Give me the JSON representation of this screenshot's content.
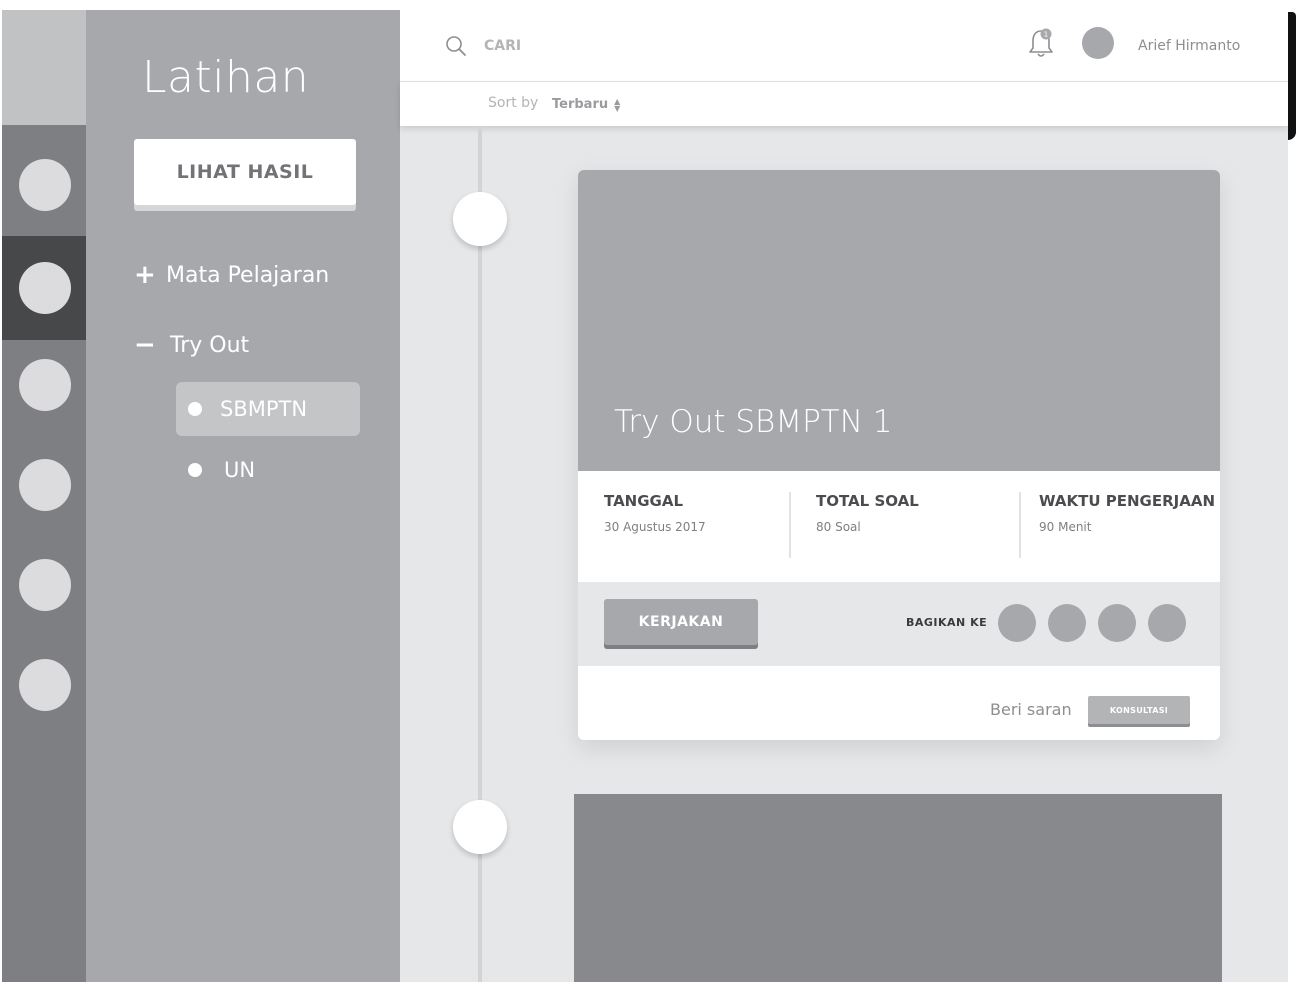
{
  "sidebar": {
    "title": "Latihan",
    "primary_button": "LIHAT HASIL",
    "menu": [
      {
        "sign": "+",
        "label": "Mata Pelajaran"
      },
      {
        "sign": "−",
        "label": "Try Out"
      }
    ],
    "submenu": [
      {
        "label": "SBMPTN",
        "active": true
      },
      {
        "label": "UN",
        "active": false
      }
    ]
  },
  "topbar": {
    "search_label": "CARI",
    "notification_count": "1",
    "user_name": "Arief Hirmanto"
  },
  "sortbar": {
    "label": "Sort by",
    "value": "Terbaru"
  },
  "card": {
    "title": "Try Out SBMPTN 1",
    "stats": [
      {
        "label": "TANGGAL",
        "value": "30 Agustus 2017"
      },
      {
        "label": "TOTAL SOAL",
        "value": "80 Soal"
      },
      {
        "label": "WAKTU PENGERJAAN",
        "value": "90 Menit"
      }
    ],
    "action_button": "KERJAKAN",
    "share_label": "BAGIKAN KE",
    "suggest_label": "Beri saran",
    "consult_button": "KONSULTASI"
  },
  "colors": {
    "rail": "#7e7f82",
    "rail_active": "#47484a",
    "sidebar": "#a7a8ab",
    "content_bg": "#e6e7e9",
    "card_cover": "#a7a8ab"
  }
}
